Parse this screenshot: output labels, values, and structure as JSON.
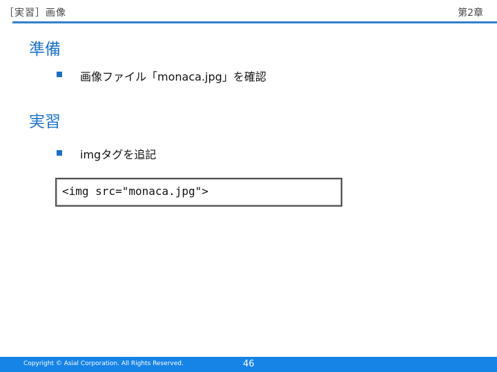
{
  "header": {
    "title": "［実習］画像",
    "chapter": "第2章"
  },
  "sections": [
    {
      "heading": "準備",
      "bullet": "画像ファイル「monaca.jpg」を確認"
    },
    {
      "heading": "実習",
      "bullet": "imgタグを追記"
    }
  ],
  "code": "<img src=\"monaca.jpg\">",
  "footer": {
    "copyright": "Copyright © Asial Corporation. All Rights Reserved.",
    "page_number": "46"
  },
  "colors": {
    "accent": "#1e73c7",
    "footer_bar": "#1683e6"
  }
}
